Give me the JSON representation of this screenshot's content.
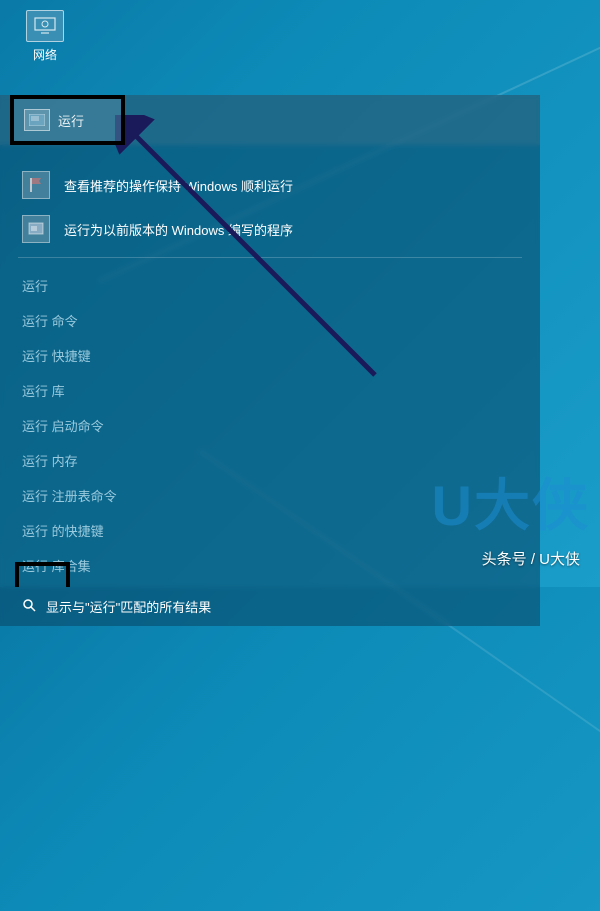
{
  "desktop": {
    "network_label": "网络"
  },
  "search": {
    "header_label": "运行",
    "results": [
      {
        "text": "查看推荐的操作保持 Windows 顺利运行"
      },
      {
        "text": "运行为以前版本的 Windows 编写的程序"
      }
    ],
    "categories": [
      "运行",
      "运行 命令",
      "运行 快捷键",
      "运行 库",
      "运行 启动命令",
      "运行 内存",
      "运行 注册表命令",
      "运行 的快捷键",
      "运行 库合集"
    ],
    "show_all_prefix": "显示与\"",
    "show_all_query": "运行",
    "show_all_suffix": "\"匹配的所有结果"
  },
  "watermark": {
    "logo_text": "U大侠",
    "attribution": "头条号 / U大侠"
  }
}
